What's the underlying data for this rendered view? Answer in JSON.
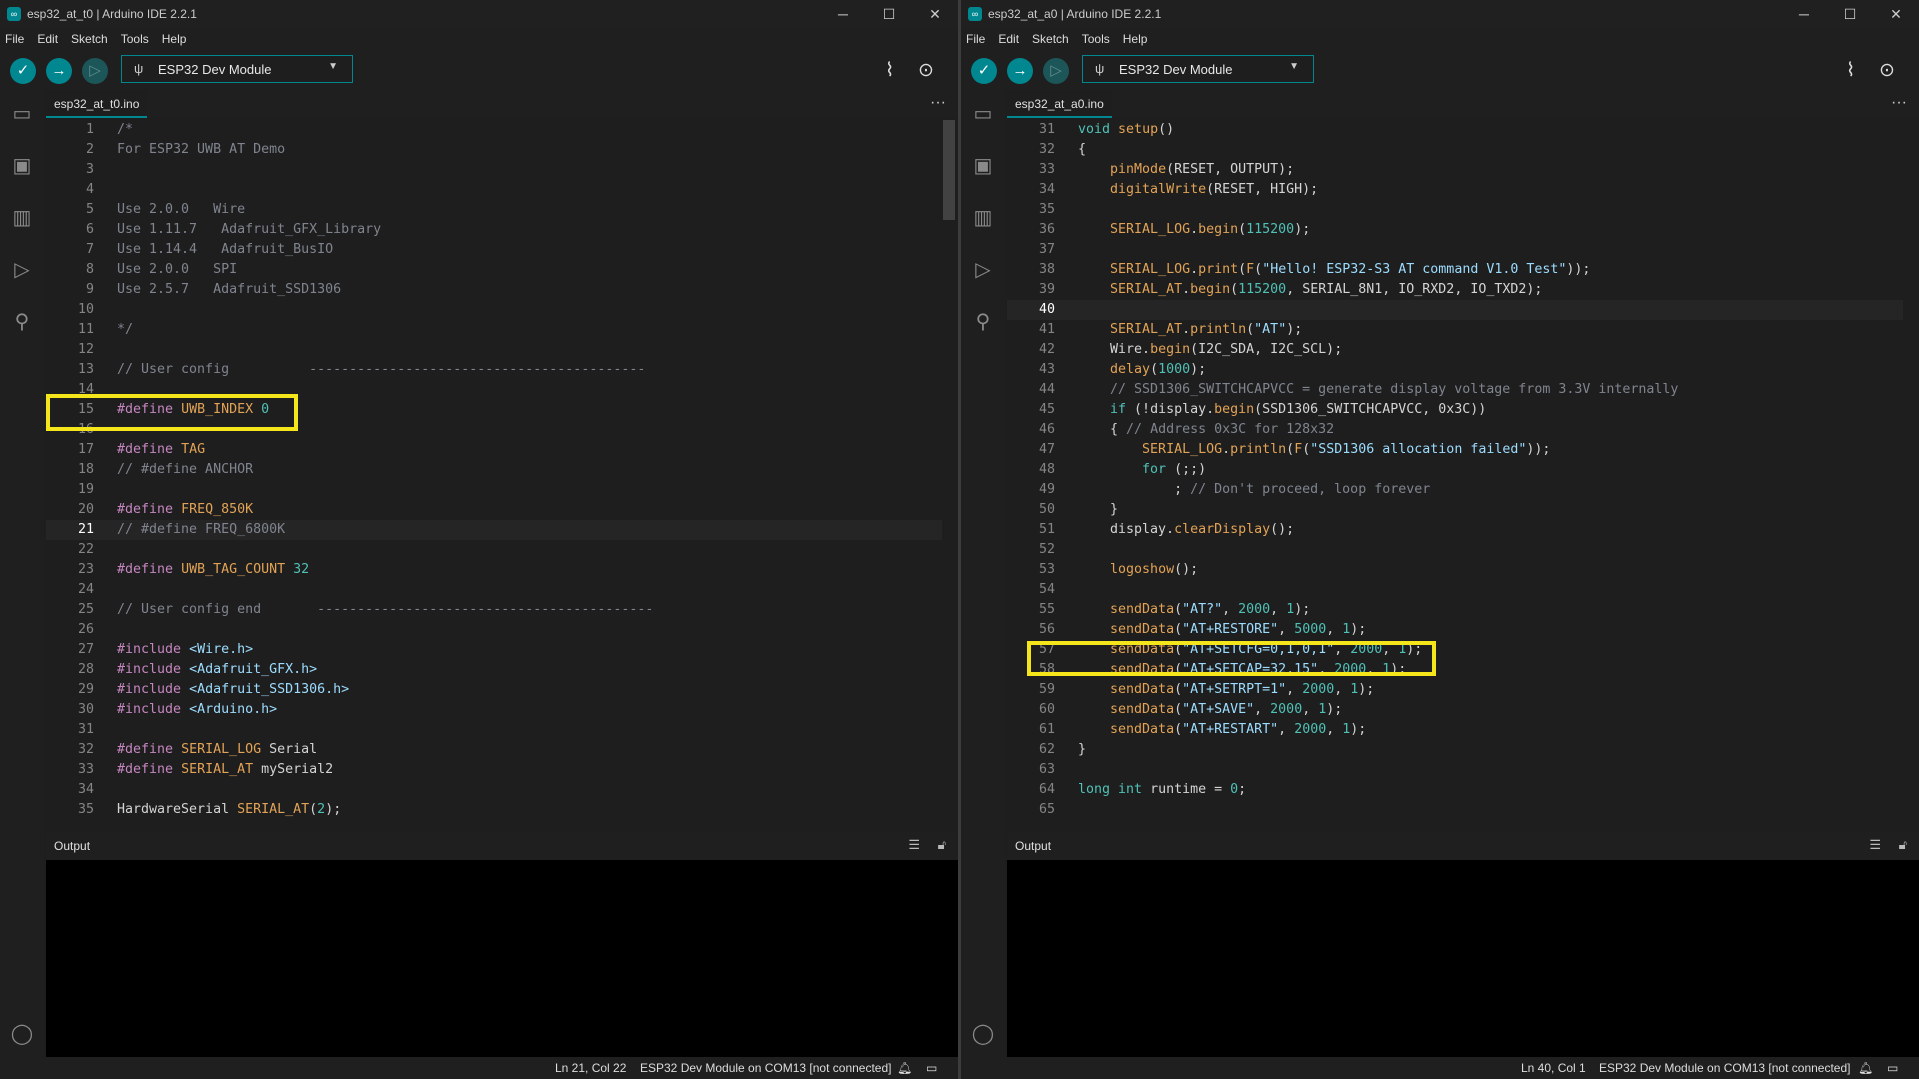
{
  "colors": {
    "accent": "#00878f",
    "highlight": "#f4e61b"
  },
  "left": {
    "window_title": "esp32_at_t0 | Arduino IDE 2.2.1",
    "menu": [
      "File",
      "Edit",
      "Sketch",
      "Tools",
      "Help"
    ],
    "board": "ESP32 Dev Module",
    "tab": "esp32_at_t0.ino",
    "output_title": "Output",
    "status_pos": "Ln 21, Col 22",
    "status_board": "ESP32 Dev Module on COM13 [not connected]",
    "current_line": 21,
    "highlighted_line": 15,
    "lines": [
      {
        "n": "1",
        "t": "/*"
      },
      {
        "n": "2",
        "t": "For ESP32 UWB AT Demo"
      },
      {
        "n": "3",
        "t": ""
      },
      {
        "n": "4",
        "t": ""
      },
      {
        "n": "5",
        "t": "Use 2.0.0   Wire"
      },
      {
        "n": "6",
        "t": "Use 1.11.7   Adafruit_GFX_Library"
      },
      {
        "n": "7",
        "t": "Use 1.14.4   Adafruit_BusIO"
      },
      {
        "n": "8",
        "t": "Use 2.0.0   SPI"
      },
      {
        "n": "9",
        "t": "Use 2.5.7   Adafruit_SSD1306"
      },
      {
        "n": "10",
        "t": ""
      },
      {
        "n": "11",
        "t": "*/"
      },
      {
        "n": "12",
        "t": ""
      },
      {
        "n": "13",
        "t": "// User config          ------------------------------------------"
      },
      {
        "n": "14",
        "t": ""
      },
      {
        "n": "15",
        "t": "#define UWB_INDEX 0"
      },
      {
        "n": "16",
        "t": ""
      },
      {
        "n": "17",
        "t": "#define TAG"
      },
      {
        "n": "18",
        "t": "// #define ANCHOR"
      },
      {
        "n": "19",
        "t": ""
      },
      {
        "n": "20",
        "t": "#define FREQ_850K"
      },
      {
        "n": "21",
        "t": "// #define FREQ_6800K"
      },
      {
        "n": "22",
        "t": ""
      },
      {
        "n": "23",
        "t": "#define UWB_TAG_COUNT 32"
      },
      {
        "n": "24",
        "t": ""
      },
      {
        "n": "25",
        "t": "// User config end       ------------------------------------------"
      },
      {
        "n": "26",
        "t": ""
      },
      {
        "n": "27",
        "t": "#include <Wire.h>"
      },
      {
        "n": "28",
        "t": "#include <Adafruit_GFX.h>"
      },
      {
        "n": "29",
        "t": "#include <Adafruit_SSD1306.h>"
      },
      {
        "n": "30",
        "t": "#include <Arduino.h>"
      },
      {
        "n": "31",
        "t": ""
      },
      {
        "n": "32",
        "t": "#define SERIAL_LOG Serial"
      },
      {
        "n": "33",
        "t": "#define SERIAL_AT mySerial2"
      },
      {
        "n": "34",
        "t": ""
      },
      {
        "n": "35",
        "t": "HardwareSerial SERIAL_AT(2);"
      }
    ]
  },
  "right": {
    "window_title": "esp32_at_a0 | Arduino IDE 2.2.1",
    "menu": [
      "File",
      "Edit",
      "Sketch",
      "Tools",
      "Help"
    ],
    "board": "ESP32 Dev Module",
    "tab": "esp32_at_a0.ino",
    "output_title": "Output",
    "status_pos": "Ln 40, Col 1",
    "status_board": "ESP32 Dev Module on COM13 [not connected]",
    "current_line": 40,
    "highlighted_line": 57,
    "lines": [
      {
        "n": "31",
        "t": "void setup()"
      },
      {
        "n": "32",
        "t": "{"
      },
      {
        "n": "33",
        "t": "    pinMode(RESET, OUTPUT);"
      },
      {
        "n": "34",
        "t": "    digitalWrite(RESET, HIGH);"
      },
      {
        "n": "35",
        "t": ""
      },
      {
        "n": "36",
        "t": "    SERIAL_LOG.begin(115200);"
      },
      {
        "n": "37",
        "t": ""
      },
      {
        "n": "38",
        "t": "    SERIAL_LOG.print(F(\"Hello! ESP32-S3 AT command V1.0 Test\"));"
      },
      {
        "n": "39",
        "t": "    SERIAL_AT.begin(115200, SERIAL_8N1, IO_RXD2, IO_TXD2);"
      },
      {
        "n": "40",
        "t": ""
      },
      {
        "n": "41",
        "t": "    SERIAL_AT.println(\"AT\");"
      },
      {
        "n": "42",
        "t": "    Wire.begin(I2C_SDA, I2C_SCL);"
      },
      {
        "n": "43",
        "t": "    delay(1000);"
      },
      {
        "n": "44",
        "t": "    // SSD1306_SWITCHCAPVCC = generate display voltage from 3.3V internally"
      },
      {
        "n": "45",
        "t": "    if (!display.begin(SSD1306_SWITCHCAPVCC, 0x3C))"
      },
      {
        "n": "46",
        "t": "    { // Address 0x3C for 128x32"
      },
      {
        "n": "47",
        "t": "        SERIAL_LOG.println(F(\"SSD1306 allocation failed\"));"
      },
      {
        "n": "48",
        "t": "        for (;;)"
      },
      {
        "n": "49",
        "t": "            ; // Don't proceed, loop forever"
      },
      {
        "n": "50",
        "t": "    }"
      },
      {
        "n": "51",
        "t": "    display.clearDisplay();"
      },
      {
        "n": "52",
        "t": ""
      },
      {
        "n": "53",
        "t": "    logoshow();"
      },
      {
        "n": "54",
        "t": ""
      },
      {
        "n": "55",
        "t": "    sendData(\"AT?\", 2000, 1);"
      },
      {
        "n": "56",
        "t": "    sendData(\"AT+RESTORE\", 5000, 1);"
      },
      {
        "n": "57",
        "t": "    sendData(\"AT+SETCFG=0,1,0,1\", 2000, 1);"
      },
      {
        "n": "58",
        "t": "    sendData(\"AT+SETCAP=32,15\", 2000, 1);"
      },
      {
        "n": "59",
        "t": "    sendData(\"AT+SETRPT=1\", 2000, 1);"
      },
      {
        "n": "60",
        "t": "    sendData(\"AT+SAVE\", 2000, 1);"
      },
      {
        "n": "61",
        "t": "    sendData(\"AT+RESTART\", 2000, 1);"
      },
      {
        "n": "62",
        "t": "}"
      },
      {
        "n": "63",
        "t": ""
      },
      {
        "n": "64",
        "t": "long int runtime = 0;"
      },
      {
        "n": "65",
        "t": ""
      }
    ]
  }
}
